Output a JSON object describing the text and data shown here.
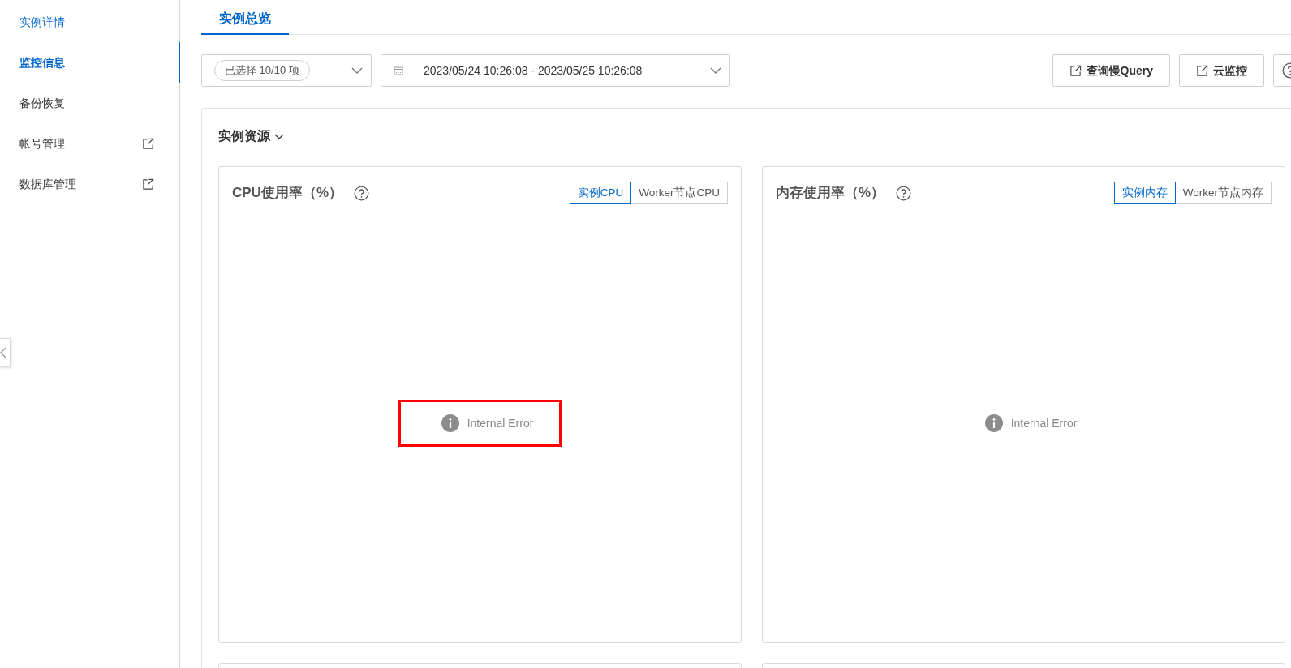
{
  "sidebar": {
    "items": [
      {
        "label": "实例详情",
        "selected": false,
        "hovered": true,
        "external": false
      },
      {
        "label": "监控信息",
        "selected": true,
        "hovered": false,
        "external": false
      },
      {
        "label": "备份恢复",
        "selected": false,
        "hovered": false,
        "external": false
      },
      {
        "label": "帐号管理",
        "selected": false,
        "hovered": false,
        "external": true
      },
      {
        "label": "数据库管理",
        "selected": false,
        "hovered": false,
        "external": true
      }
    ]
  },
  "tabs": [
    {
      "label": "实例总览",
      "selected": true
    }
  ],
  "toolbar": {
    "metric_select": {
      "value": "已选择 10/10 项"
    },
    "time_range": {
      "value": "2023/05/24 10:26:08 - 2023/05/25 10:26:08"
    },
    "buttons": [
      {
        "label": "查询慢Query",
        "kind": "external"
      },
      {
        "label": "云监控",
        "kind": "external"
      },
      {
        "kind": "help"
      }
    ]
  },
  "section": {
    "title": "实例资源",
    "expanded": true,
    "panels": [
      {
        "title": "CPU使用率（%）",
        "options": [
          {
            "label": "实例CPU",
            "selected": true
          },
          {
            "label": "Worker节点CPU",
            "selected": false
          }
        ],
        "message": "Internal Error",
        "highlighted": true
      },
      {
        "title": "内存使用率（%）",
        "options": [
          {
            "label": "实例内存",
            "selected": true
          },
          {
            "label": "Worker节点内存",
            "selected": false
          }
        ],
        "message": "Internal Error",
        "highlighted": false
      }
    ]
  }
}
